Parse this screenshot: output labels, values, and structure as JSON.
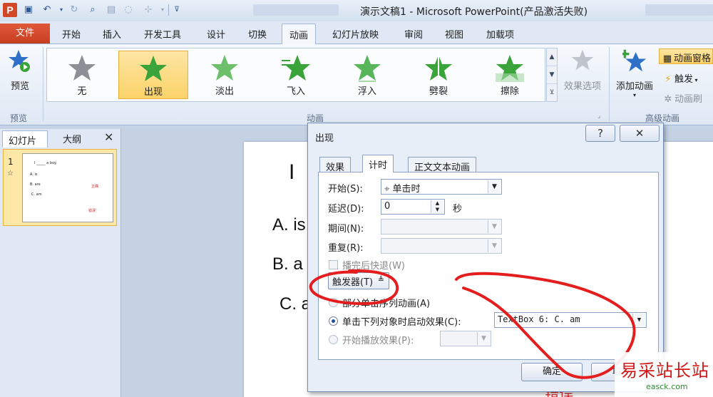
{
  "window": {
    "title": "演示文稿1 - Microsoft PowerPoint(产品激活失败)"
  },
  "tabs": {
    "file": "文件",
    "items": [
      "开始",
      "插入",
      "开发工具",
      "设计",
      "切换",
      "动画",
      "幻灯片放映",
      "审阅",
      "视图",
      "加载项"
    ],
    "active": "动画"
  },
  "ribbon": {
    "preview": {
      "button": "预览",
      "group": "预览"
    },
    "animation_gallery": {
      "items": [
        "无",
        "出现",
        "淡出",
        "飞入",
        "浮入",
        "劈裂",
        "擦除"
      ],
      "selected": "出现",
      "group": "动画"
    },
    "effect_options": "效果选项",
    "advanced": {
      "add_animation": "添加动画",
      "animation_pane": "动画窗格",
      "trigger": "触发",
      "animation_painter": "动画刷",
      "group": "高级动画"
    },
    "colors": {
      "star_green": "#3aa33a",
      "star_gray": "#8c8f96",
      "selected_bg": "#fbd36a"
    }
  },
  "left_pane": {
    "tabs": [
      "幻灯片",
      "大纲"
    ],
    "close": "✕",
    "slide_number": "1",
    "thumb_lines": [
      "I _____ a boy.",
      "A. is",
      "B. are",
      "C. am",
      "正确",
      "错误"
    ]
  },
  "slide": {
    "line1": "I",
    "option_a": "A.  is",
    "option_b": "B.  a",
    "option_c": "C.  a",
    "bottom_red": "错误"
  },
  "dialog": {
    "title": "出现",
    "help": "?",
    "close": "✕",
    "tabs": [
      "效果",
      "计时",
      "正文文本动画"
    ],
    "active_tab": "计时",
    "start_label": "开始(S):",
    "start_value": "单击时",
    "delay_label": "延迟(D):",
    "delay_value": "0",
    "delay_unit": "秒",
    "duration_label": "期间(N):",
    "repeat_label": "重复(R):",
    "rewind_label": "播完后快退(W)",
    "trigger_button": "触发器(T)",
    "radio_sequence": "部分单击序列动画(A)",
    "radio_click": "单击下列对象时启动效果(C):",
    "click_object": "TextBox 6: C.   am",
    "radio_play": "开始播放效果(P):",
    "ok": "确定",
    "cancel": "取消"
  },
  "watermark": {
    "big": "易采站长站",
    "small": "easck.com"
  }
}
